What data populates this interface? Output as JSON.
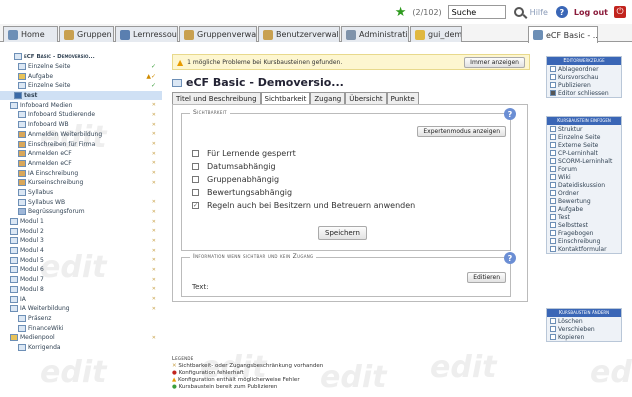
{
  "top": {
    "counter": "(2/102)",
    "search_value": "Suche",
    "help": "Hilfe",
    "logout": "Log out"
  },
  "tabs": [
    {
      "label": "Home"
    },
    {
      "label": "Gruppen"
    },
    {
      "label": "Lernressourcen"
    },
    {
      "label": "Gruppenverwaltung"
    },
    {
      "label": "Benutzerverwaltung"
    },
    {
      "label": "Administration"
    },
    {
      "label": "gui_demo"
    },
    {
      "label": "eCF Basic - ..."
    }
  ],
  "sidebar": {
    "items": [
      {
        "label": "eCF Basic - Demoversio...",
        "status": ""
      },
      {
        "label": "Einzelne Seite",
        "status": "ok"
      },
      {
        "label": "Aufgabe",
        "status": "warn"
      },
      {
        "label": "Einzelne Seite",
        "status": "ok"
      },
      {
        "label": "test",
        "status": ""
      },
      {
        "label": "Infoboard Medien",
        "status": "x"
      },
      {
        "label": "Infoboard Studierende",
        "status": "x"
      },
      {
        "label": "Infoboard WB",
        "status": "x"
      },
      {
        "label": "Anmelden Weiterbildung",
        "status": "x"
      },
      {
        "label": "Einschreiben für Firma",
        "status": "x"
      },
      {
        "label": "Anmelden eCF",
        "status": "x"
      },
      {
        "label": "Anmelden eCF",
        "status": "x"
      },
      {
        "label": "IA Einschreibung",
        "status": "x"
      },
      {
        "label": "Kurseinschreibung",
        "status": "x"
      },
      {
        "label": "Syllabus",
        "status": ""
      },
      {
        "label": "Syllabus WB",
        "status": "x"
      },
      {
        "label": "Begrüssungsforum",
        "status": "x"
      },
      {
        "label": "Modul 1",
        "status": "x"
      },
      {
        "label": "Modul 2",
        "status": "x"
      },
      {
        "label": "Modul 3",
        "status": "x"
      },
      {
        "label": "Modul 4",
        "status": "x"
      },
      {
        "label": "Modul 5",
        "status": "x"
      },
      {
        "label": "Modul 6",
        "status": "x"
      },
      {
        "label": "Modul 7",
        "status": "x"
      },
      {
        "label": "Modul 8",
        "status": "x"
      },
      {
        "label": "IA",
        "status": "x"
      },
      {
        "label": "IA Weiterbildung",
        "status": "x"
      },
      {
        "label": "Präsenz",
        "status": ""
      },
      {
        "label": "FinanceWiki",
        "status": ""
      },
      {
        "label": "Medienpool",
        "status": "x"
      },
      {
        "label": "Korrigenda",
        "status": ""
      }
    ]
  },
  "main": {
    "alert_text": "1 mögliche Probleme bei Kursbausteinen gefunden.",
    "alert_button": "Immer anzeigen",
    "title": "eCF Basic - Demoversio...",
    "subtabs": [
      "Titel und Beschreibung",
      "Sichtbarkeit",
      "Zugang",
      "Übersicht",
      "Punkte"
    ],
    "visibility": {
      "legend": "Sichtbarkeit",
      "expert_button": "Expertenmodus anzeigen",
      "options": [
        {
          "label": "Für Lernende gesperrt",
          "checked": false
        },
        {
          "label": "Datumsabhängig",
          "checked": false
        },
        {
          "label": "Gruppenabhängig",
          "checked": false
        },
        {
          "label": "Bewertungsabhängig",
          "checked": false
        },
        {
          "label": "Regeln auch bei Besitzern und Betreuern anwenden",
          "checked": true
        }
      ],
      "save_button": "Speichern"
    },
    "info": {
      "legend": "Information wenn sichtbar und kein Zugang",
      "edit_button": "Editieren",
      "text_label": "Text:"
    },
    "legend": {
      "title": "Legende",
      "items": [
        "Sichtbarkeit- oder Zugangsbeschränkung vorhanden",
        "Konfiguration fehlerhaft",
        "Konfiguration enthält möglicherweise Fehler",
        "Kursbaustein bereit zum Publizieren"
      ]
    }
  },
  "right": {
    "editor_tools": {
      "title": "Editorwerkzeuge",
      "items": [
        "Ablageordner",
        "Kursvorschau",
        "Publizieren",
        "Editor schliessen"
      ]
    },
    "insert": {
      "title": "Kursbaustein einfügen",
      "items": [
        "Struktur",
        "Einzelne Seite",
        "Externe Seite",
        "CP-Lerninhalt",
        "SCORM-Lerninhalt",
        "Forum",
        "Wiki",
        "Dateidiskussion",
        "Ordner",
        "Bewertung",
        "Aufgabe",
        "Test",
        "Selbsttest",
        "Fragebogen",
        "Einschreibung",
        "Kontaktformular"
      ]
    },
    "edit": {
      "title": "Kursbaustein ändern",
      "items": [
        "Löschen",
        "Verschieben",
        "Kopieren"
      ]
    }
  },
  "watermark": "edit"
}
